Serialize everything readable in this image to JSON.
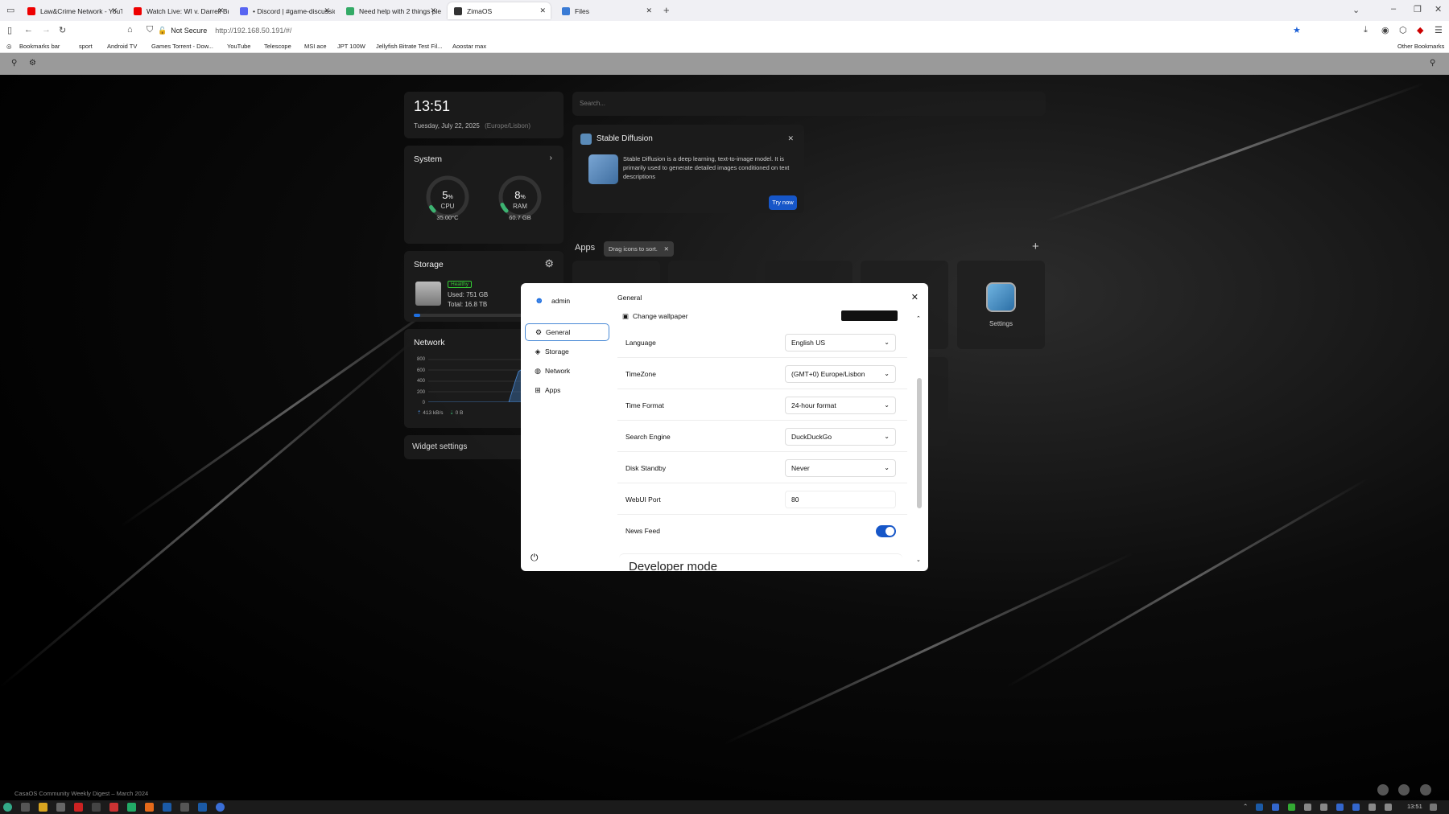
{
  "browser": {
    "tabs": [
      {
        "title": "Law&Crime Network - YouTube",
        "color": "#e00"
      },
      {
        "title": "Watch Live: WI v. Darrell Brook",
        "color": "#e00"
      },
      {
        "title": "• Discord | #game-discussion | 5",
        "color": "#5865f2"
      },
      {
        "title": "Need help with 2 things please",
        "color": "#3a6"
      },
      {
        "title": "ZimaOS",
        "color": "#333"
      },
      {
        "title": "Files",
        "color": "#3a7bd5"
      }
    ],
    "not_secure": "Not Secure",
    "url": "http://192.168.50.191/#/",
    "bookmarks": [
      "Bookmarks bar",
      "sport",
      "Android TV",
      "Games Torrent - Dow...",
      "YouTube",
      "Telescope",
      "MSI ace",
      "JPT 100W",
      "Jellyfish Bitrate Test Fil...",
      "Aoostar max"
    ],
    "other_bookmarks": "Other Bookmarks"
  },
  "clock": {
    "time": "13:51",
    "date": "Tuesday, July 22, 2025",
    "zone": "(Europe/Lisbon)"
  },
  "system": {
    "title": "System",
    "cpu": {
      "value": "5",
      "unit": "%",
      "label": "CPU",
      "sub": "35.00°C",
      "percent": 5
    },
    "ram": {
      "value": "8",
      "unit": "%",
      "label": "RAM",
      "sub": "60.7 GB",
      "percent": 8
    }
  },
  "storage": {
    "title": "Storage",
    "status": "Healthy",
    "used": "Used: 751 GB",
    "total": "Total: 16.8 TB",
    "fill_fraction": 0.045
  },
  "network": {
    "title": "Network",
    "ticks": [
      "800",
      "600",
      "400",
      "200",
      "0"
    ],
    "up": "413 kB/s",
    "down": "0 B"
  },
  "widget_settings": "Widget settings",
  "search": {
    "placeholder": "Search..."
  },
  "promo": {
    "title": "Stable Diffusion",
    "text": "Stable Diffusion is a deep learning, text-to-image model. It is primarily used to generate detailed images conditioned on text descriptions",
    "button": "Try now"
  },
  "apps": {
    "title": "Apps",
    "hint": "Drag icons to sort.",
    "settings_label": "Settings"
  },
  "settings_panel": {
    "user": "admin",
    "header": "General",
    "nav": [
      "General",
      "Storage",
      "Network",
      "Apps"
    ],
    "change_wallpaper": "Change wallpaper",
    "rows": [
      {
        "label": "Language",
        "value": "English US"
      },
      {
        "label": "TimeZone",
        "value": "(GMT+0) Europe/Lisbon"
      },
      {
        "label": "Time Format",
        "value": "24-hour format"
      },
      {
        "label": "Search Engine",
        "value": "DuckDuckGo"
      },
      {
        "label": "Disk Standby",
        "value": "Never"
      },
      {
        "label": "WebUI Port",
        "value": "80"
      },
      {
        "label": "News Feed",
        "value": "on"
      }
    ],
    "developer_mode": "Developer mode"
  },
  "footer_text": "CasaOS Community Weekly Digest – March 2024",
  "taskbar": {
    "time": "13:51"
  }
}
